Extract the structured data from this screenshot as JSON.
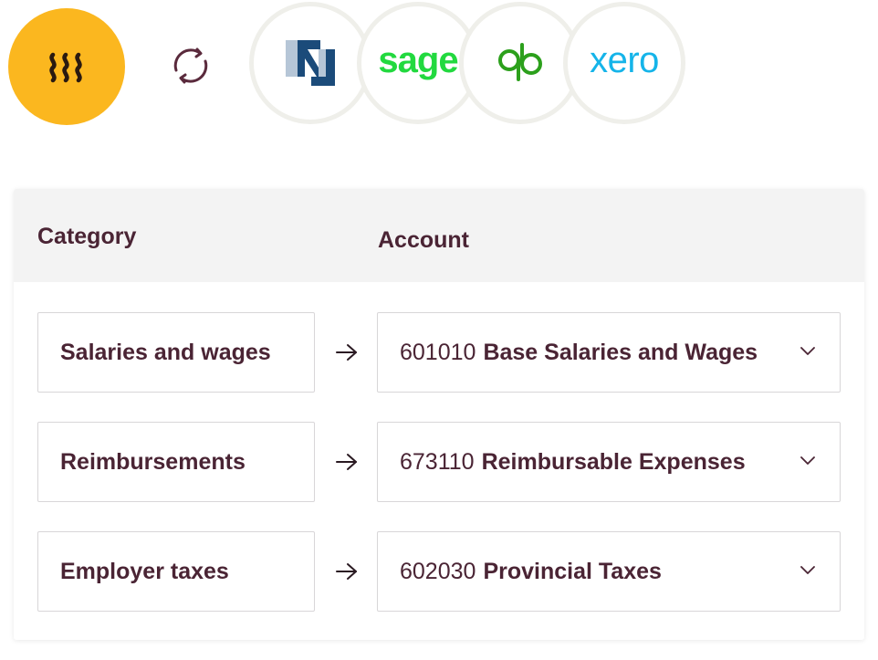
{
  "integrations": {
    "brand_icon": "wave-lines-icon",
    "sync_icon": "sync-arrows-icon",
    "partners": [
      {
        "name": "netsuite",
        "icon": "netsuite-n-logo"
      },
      {
        "name": "sage",
        "wordmark": "sage",
        "color": "#22d93f"
      },
      {
        "name": "quickbooks",
        "icon": "qb-logo",
        "color": "#2ca01c"
      },
      {
        "name": "xero",
        "wordmark": "xero",
        "color": "#15b4e9"
      }
    ],
    "colors": {
      "brand": "#fbb71f",
      "text": "#4a2434",
      "header_bg": "#f3f3f3"
    }
  },
  "table": {
    "headers": {
      "category": "Category",
      "account": "Account"
    },
    "rows": [
      {
        "category": "Salaries and wages",
        "account_code": "601010",
        "account_name": "Base Salaries and Wages"
      },
      {
        "category": "Reimbursements",
        "account_code": "673110",
        "account_name": "Reimbursable Expenses"
      },
      {
        "category": "Employer taxes",
        "account_code": "602030",
        "account_name": "Provincial Taxes"
      }
    ]
  }
}
